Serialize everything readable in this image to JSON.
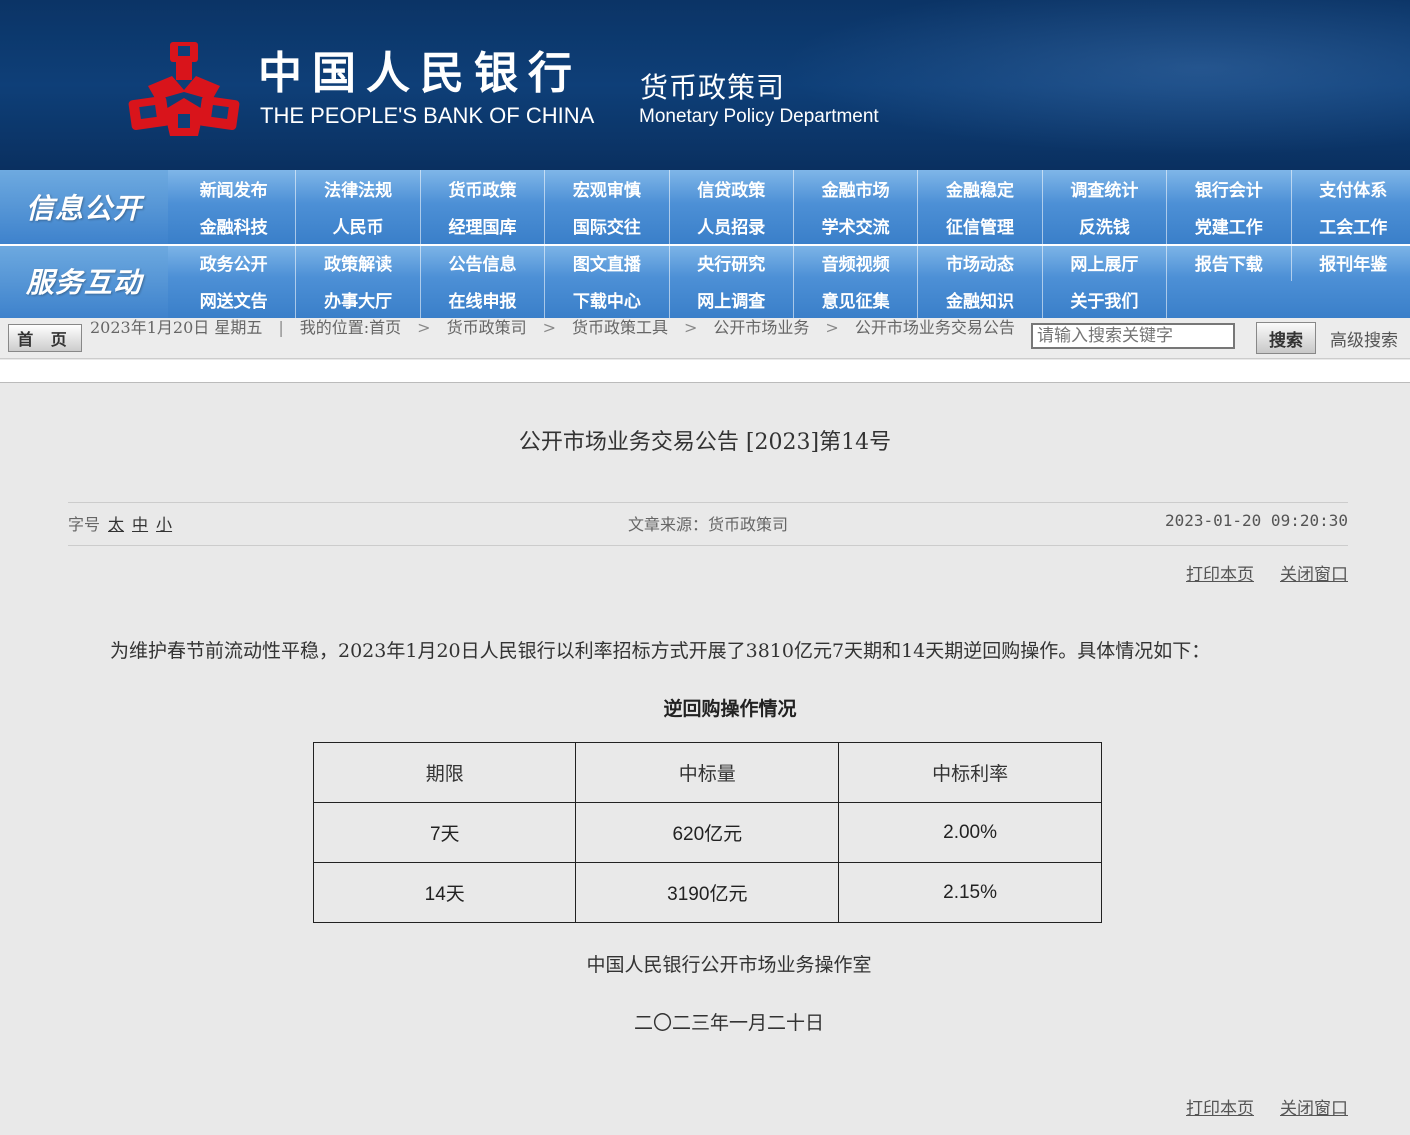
{
  "header": {
    "bank_cn": "中国人民银行",
    "bank_en": "THE PEOPLE'S BANK OF CHINA",
    "dept_cn": "货币政策司",
    "dept_en": "Monetary Policy Department",
    "emblem_color": "#d9141b"
  },
  "nav": {
    "info_label": "信息公开",
    "service_label": "服务互动",
    "info_items": [
      "新闻发布",
      "法律法规",
      "货币政策",
      "宏观审慎",
      "信贷政策",
      "金融市场",
      "金融稳定",
      "调查统计",
      "银行会计",
      "支付体系",
      "金融科技",
      "人民币",
      "经理国库",
      "国际交往",
      "人员招录",
      "学术交流",
      "征信管理",
      "反洗钱",
      "党建工作",
      "工会工作"
    ],
    "service_items": [
      "政务公开",
      "政策解读",
      "公告信息",
      "图文直播",
      "央行研究",
      "音频视频",
      "市场动态",
      "网上展厅",
      "报告下载",
      "报刊年鉴",
      "网送文告",
      "办事大厅",
      "在线申报",
      "下载中心",
      "网上调查",
      "意见征集",
      "金融知识",
      "关于我们"
    ]
  },
  "crumb": {
    "home": "首 页",
    "date": "2023年1月20日 星期五",
    "location_label": "我的位置:首页",
    "path": [
      "货币政策司",
      "货币政策工具",
      "公开市场业务",
      "公开市场业务交易公告"
    ],
    "search_placeholder": "请输入搜索关键字",
    "search_btn": "搜索",
    "advanced": "高级搜索"
  },
  "article": {
    "title": "公开市场业务交易公告 [2023]第14号",
    "font_label": "字号",
    "font_sizes": [
      "太",
      "中",
      "小"
    ],
    "source": "文章来源：货币政策司",
    "datetime": "2023-01-20 09:20:30",
    "print": "打印本页",
    "close": "关闭窗口",
    "paragraph": "为维护春节前流动性平稳，2023年1月20日人民银行以利率招标方式开展了3810亿元7天期和14天期逆回购操作。具体情况如下：",
    "table_title": "逆回购操作情况",
    "table": {
      "headers": [
        "期限",
        "中标量",
        "中标利率"
      ],
      "rows": [
        [
          "7天",
          "620亿元",
          "2.00%"
        ],
        [
          "14天",
          "3190亿元",
          "2.15%"
        ]
      ]
    },
    "signature": "中国人民银行公开市场业务操作室",
    "sign_date": "二〇二三年一月二十日"
  }
}
